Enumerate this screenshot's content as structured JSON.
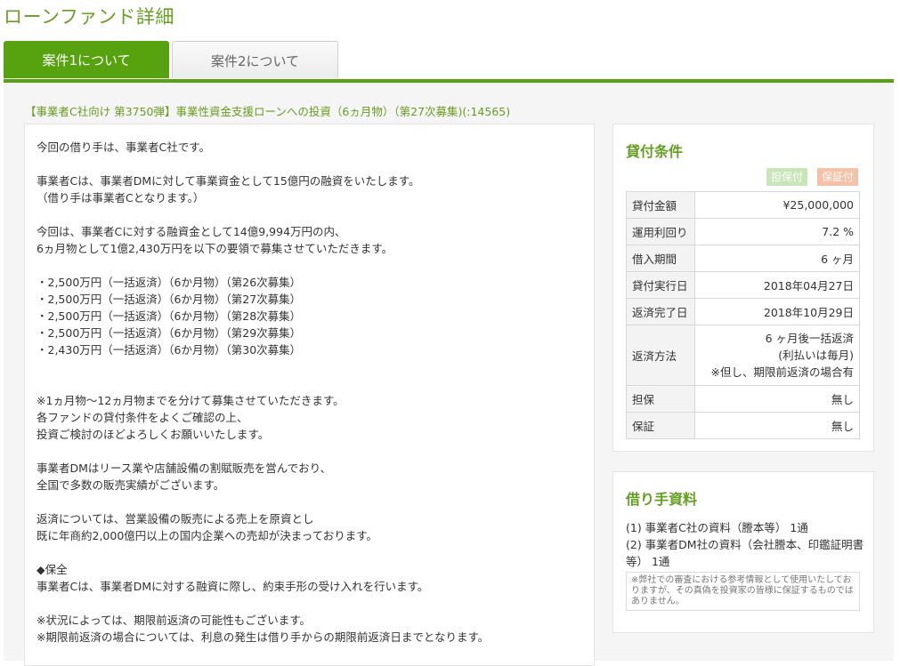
{
  "page_title": "ローンファンド詳細",
  "tabs": [
    {
      "label": "案件1について",
      "active": true
    },
    {
      "label": "案件2について",
      "active": false
    }
  ],
  "fund_title": "【事業者C社向け 第3750弾】事業性資金支援ローンへの投資（6ヵ月物）（第27次募集)(:14565)",
  "description": [
    "今回の借り手は、事業者C社です。",
    "事業者Cは、事業者DMに対して事業資金として15億円の融資をいたします。",
    "（借り手は事業者Cとなります。）",
    "今回は、事業者Cに対する融資金として14億9,994万円の内、",
    "6ヵ月物として1億2,430万円を以下の要領で募集させていただきます。",
    "・2,500万円（一括返済）（6か月物）（第26次募集）",
    "・2,500万円（一括返済）（6か月物）（第27次募集）",
    "・2,500万円（一括返済）（6か月物）（第28次募集）",
    "・2,500万円（一括返済）（6か月物）（第29次募集）",
    "・2,430万円（一括返済）（6か月物）（第30次募集）",
    "※1ヵ月物～12ヵ月物までを分けて募集させていただきます。",
    "各ファンドの貸付条件をよくご確認の上、",
    "投資ご検討のほどよろしくお願いいたします。",
    "事業者DMはリース業や店舗設備の割賦販売を営んでおり、",
    "全国で多数の販売実績がございます。",
    "返済については、営業設備の販売による売上を原資とし",
    "既に年商約2,000億円以上の国内企業への売却が決まっております。",
    "◆保全",
    "事業者Cは、事業者DMに対する融資に際し、約束手形の受け入れを行います。",
    "※状況によっては、期限前返済の可能性もございます。",
    "※期限前返済の場合については、利息の発生は借り手からの期限前返済日までとなります。"
  ],
  "loan_terms": {
    "heading": "貸付条件",
    "badges": {
      "collateral": "担保付",
      "guarantee": "保証付"
    },
    "rows": [
      {
        "label": "貸付金額",
        "value": "¥25,000,000"
      },
      {
        "label": "運用利回り",
        "value": "7.2 %"
      },
      {
        "label": "借入期間",
        "value": "6 ヶ月"
      },
      {
        "label": "貸付実行日",
        "value": "2018年04月27日"
      },
      {
        "label": "返済完了日",
        "value": "2018年10月29日"
      },
      {
        "label": "返済方法",
        "value_lines": [
          "6 ヶ月後一括返済",
          "(利払いは毎月)",
          "※但し、期限前返済の場合有"
        ]
      },
      {
        "label": "担保",
        "value": "無し"
      },
      {
        "label": "保証",
        "value": "無し"
      }
    ]
  },
  "borrower_docs": {
    "heading": "借り手資料",
    "items": [
      "(1) 事業者C社の資料（謄本等） 1通",
      "(2) 事業者DM社の資料（会社謄本、印鑑証明書",
      "等） 1通"
    ],
    "note": "※弊社での審査における参考情報として使用いたしておりますが、その真偽を投資家の皆様に保証するものではありません。"
  },
  "colors": {
    "accent": "#56a30f",
    "title_green": "#66a023"
  }
}
